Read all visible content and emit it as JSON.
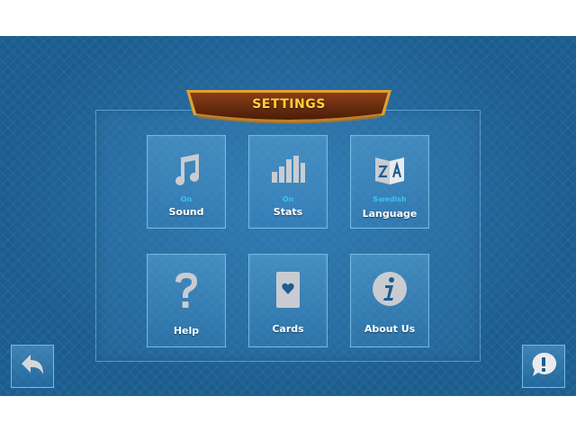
{
  "header": {
    "title": "SETTINGS"
  },
  "tiles": [
    {
      "id": "sound",
      "label": "Sound",
      "status": "On",
      "icon": "music-note-icon"
    },
    {
      "id": "stats",
      "label": "Stats",
      "status": "On",
      "icon": "bar-chart-icon"
    },
    {
      "id": "language",
      "label": "Language",
      "status": "Swedish",
      "icon": "translate-icon"
    },
    {
      "id": "help",
      "label": "Help",
      "status": "",
      "icon": "question-mark-icon"
    },
    {
      "id": "cards",
      "label": "Cards",
      "status": "",
      "icon": "playing-card-icon"
    },
    {
      "id": "about",
      "label": "About Us",
      "status": "",
      "icon": "info-icon"
    }
  ],
  "footer": {
    "back_icon": "back-arrow-icon",
    "feedback_icon": "speech-bubble-exclamation-icon"
  },
  "colors": {
    "background": "#1c5d8f",
    "banner": "#6b2d10",
    "banner_border": "#e0a030",
    "title": "#ffd23a",
    "status": "#39c3f2",
    "icon": "#c8ccd2"
  }
}
